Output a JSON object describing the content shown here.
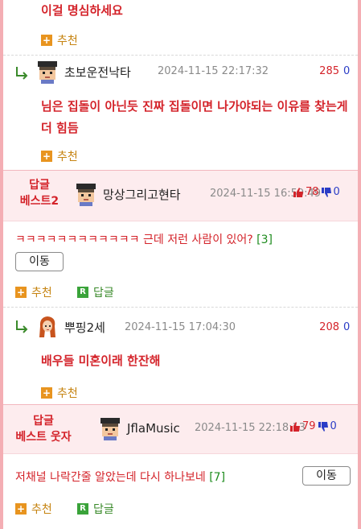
{
  "comments": [
    {
      "text": "이걸 명심하세요",
      "recommend_label": "추천"
    },
    {
      "author": "초보운전낙타",
      "date": "2024-11-15 22:17:32",
      "up": "285",
      "down": "0",
      "text": "님은 집돌이 아닌듯 진짜 집돌이면 나가야되는 이유를 찾는게 더 힘듬",
      "recommend_label": "추천"
    },
    {
      "best_label_line1": "답글",
      "best_label_line2": "베스트2",
      "author": "망상그리고현타",
      "date": "2024-11-15 16:59:49",
      "up": "78",
      "down": "0",
      "text": "ㅋㅋㅋㅋㅋㅋㅋㅋㅋㅋㅋㅋ 근데 저런 사람이 있어?",
      "count": "[3]",
      "move_label": "이동",
      "recommend_label": "추천",
      "reply_label": "답글"
    },
    {
      "author": "뿌핑2세",
      "date": "2024-11-15 17:04:30",
      "up": "208",
      "down": "0",
      "text": "배우들 미혼이래 한잔해",
      "recommend_label": "추천"
    },
    {
      "best_label_line1": "답글",
      "best_label_line2": "베스트 웃자",
      "author": "JflaMusic",
      "date": "2024-11-15 22:18:13",
      "up": "79",
      "down": "0",
      "text": "저채널 나락간줄 알았는데 다시 하나보네",
      "count": "[7]",
      "move_label": "이동",
      "recommend_label": "추천",
      "reply_label": "답글"
    }
  ],
  "colors": {
    "accent_red": "#d4232a",
    "best_bg": "#fdecee",
    "frame_pink": "#f4aeb4",
    "recommend_orange": "#e8941f",
    "reply_green": "#3aa33a",
    "down_blue": "#2a3cc6"
  },
  "icons": {
    "reply_arrow": "reply-arrow-icon",
    "recommend": "plus-icon",
    "reply": "r-icon",
    "thumb_up": "thumb-up-icon",
    "thumb_down": "thumb-down-icon"
  }
}
